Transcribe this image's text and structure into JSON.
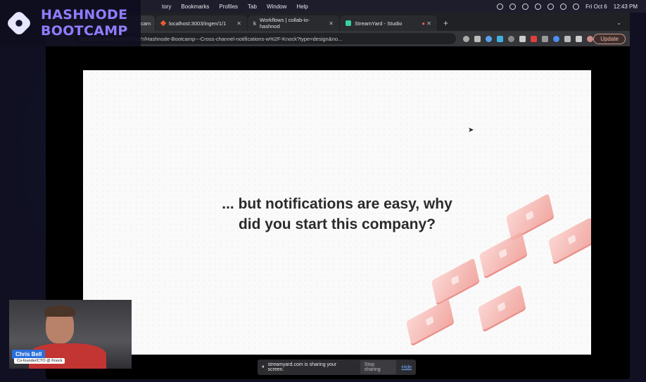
{
  "branding": {
    "line1": "HASHNODE",
    "line2": "BOOTCAMP"
  },
  "menubar": {
    "menus": [
      "tory",
      "Bookmarks",
      "Profiles",
      "Tab",
      "Window",
      "Help"
    ],
    "date": "Fri Oct 6",
    "time": "12:43 PM"
  },
  "tabs": [
    {
      "label": "cam",
      "active": true
    },
    {
      "label": "localhost:3003/ingen/1/1",
      "active": false
    },
    {
      "label": "Workflows | collab-io-hashnod",
      "active": false
    },
    {
      "label": "StreamYard - Studio",
      "active": false
    }
  ],
  "toolbar": {
    "url": "59Q9DEnXBeU6YdPFFqYr/Hashnode-Bootcamp---Cross-channel-notifications-w%2F-Knock?type=design&no...",
    "update_label": "Update"
  },
  "slide": {
    "title": "... but notifications are easy, why\ndid you start this company?"
  },
  "share_bar": {
    "message": "streamyard.com is sharing your screen.",
    "stop_label": "Stop sharing",
    "hide_label": "Hide"
  },
  "speaker": {
    "name": "Chris Bell",
    "title": "Co-founder/CTO @ Knock"
  },
  "colors": {
    "accent": "#8f7dff",
    "tile": "#f19a93",
    "name_tag": "#2a6fdb"
  }
}
